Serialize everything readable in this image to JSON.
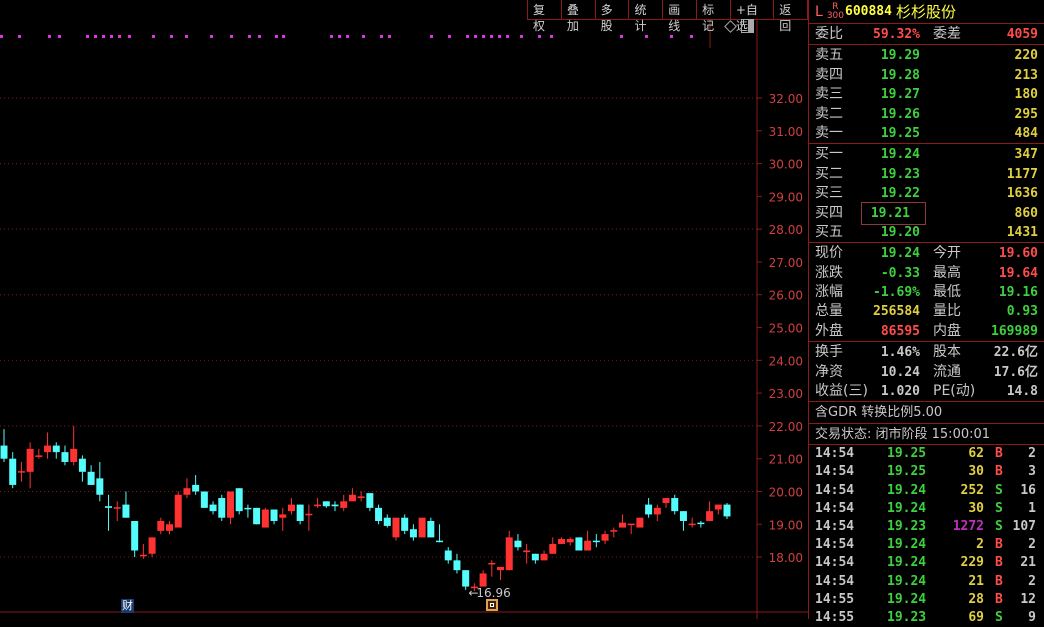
{
  "toolbar": [
    "复权",
    "叠加",
    "多股",
    "统计",
    "画线",
    "标记",
    "+自选",
    "返回"
  ],
  "header": {
    "market": "L",
    "tag_top": "R",
    "tag_bottom": "300",
    "code": "600884",
    "name": "杉杉股份"
  },
  "weibi": {
    "label": "委比",
    "value": "59.32%",
    "diff_label": "委差",
    "diff": "4059"
  },
  "sells": [
    {
      "label": "卖五",
      "price": "19.29",
      "vol": "220"
    },
    {
      "label": "卖四",
      "price": "19.28",
      "vol": "213"
    },
    {
      "label": "卖三",
      "price": "19.27",
      "vol": "180"
    },
    {
      "label": "卖二",
      "price": "19.26",
      "vol": "295"
    },
    {
      "label": "卖一",
      "price": "19.25",
      "vol": "484"
    }
  ],
  "buys": [
    {
      "label": "买一",
      "price": "19.24",
      "vol": "347"
    },
    {
      "label": "买二",
      "price": "19.23",
      "vol": "1177"
    },
    {
      "label": "买三",
      "price": "19.22",
      "vol": "1636"
    },
    {
      "label": "买四",
      "price": "19.21",
      "vol": "860"
    },
    {
      "label": "买五",
      "price": "19.20",
      "vol": "1431"
    }
  ],
  "quote": [
    {
      "l1": "现价",
      "v1": "19.24",
      "c1": "g",
      "l2": "今开",
      "v2": "19.60",
      "c2": "r"
    },
    {
      "l1": "涨跌",
      "v1": "-0.33",
      "c1": "g",
      "l2": "最高",
      "v2": "19.64",
      "c2": "r"
    },
    {
      "l1": "涨幅",
      "v1": "-1.69%",
      "c1": "g",
      "l2": "最低",
      "v2": "19.16",
      "c2": "g"
    },
    {
      "l1": "总量",
      "v1": "256584",
      "c1": "y",
      "l2": "量比",
      "v2": "0.93",
      "c2": "g"
    },
    {
      "l1": "外盘",
      "v1": "86595",
      "c1": "r",
      "l2": "内盘",
      "v2": "169989",
      "c2": "g"
    }
  ],
  "fund": [
    {
      "l1": "换手",
      "v1": "1.46%",
      "l2": "股本",
      "v2": "22.6亿"
    },
    {
      "l1": "净资",
      "v1": "10.24",
      "l2": "流通",
      "v2": "17.6亿"
    },
    {
      "l1": "收益(三)",
      "v1": "1.020",
      "l2": "PE(动)",
      "v2": "14.8"
    }
  ],
  "gdr": "含GDR 转换比例5.00",
  "status": "交易状态: 闭市阶段 15:00:01",
  "ticks": [
    {
      "t": "14:54",
      "p": "19.25",
      "v": "62",
      "bs": "B",
      "n": "2"
    },
    {
      "t": "14:54",
      "p": "19.25",
      "v": "30",
      "bs": "B",
      "n": "3"
    },
    {
      "t": "14:54",
      "p": "19.24",
      "v": "252",
      "bs": "S",
      "n": "16"
    },
    {
      "t": "14:54",
      "p": "19.24",
      "v": "30",
      "bs": "S",
      "n": "1"
    },
    {
      "t": "14:54",
      "p": "19.23",
      "v": "1272",
      "bs": "S",
      "n": "107"
    },
    {
      "t": "14:54",
      "p": "19.24",
      "v": "2",
      "bs": "B",
      "n": "2"
    },
    {
      "t": "14:54",
      "p": "19.24",
      "v": "229",
      "bs": "B",
      "n": "21"
    },
    {
      "t": "14:54",
      "p": "19.24",
      "v": "21",
      "bs": "B",
      "n": "2"
    },
    {
      "t": "14:55",
      "p": "19.24",
      "v": "28",
      "bs": "B",
      "n": "12"
    },
    {
      "t": "14:55",
      "p": "19.23",
      "v": "69",
      "bs": "S",
      "n": "9"
    }
  ],
  "chart_data": {
    "type": "candlestick",
    "y_ticks": [
      "32.00",
      "31.00",
      "30.00",
      "29.00",
      "28.00",
      "27.00",
      "26.00",
      "25.00",
      "24.00",
      "23.00",
      "22.00",
      "21.00",
      "20.00",
      "19.00",
      "18.00"
    ],
    "ylim": [
      18,
      32
    ],
    "low_marker": "16.96",
    "event_marker": "财",
    "colors": {
      "up": "#ff3232",
      "down": "#54fcfc",
      "flat": "#ffffff"
    },
    "ohlc": [
      [
        21.4,
        21.9,
        20.9,
        21.0
      ],
      [
        21.0,
        21.2,
        20.1,
        20.2
      ],
      [
        20.6,
        20.9,
        20.3,
        20.62
      ],
      [
        20.6,
        21.5,
        20.1,
        21.3
      ],
      [
        21.1,
        21.3,
        21.0,
        21.1
      ],
      [
        21.2,
        21.8,
        21.0,
        21.4
      ],
      [
        21.4,
        21.5,
        21.0,
        21.2
      ],
      [
        21.2,
        21.4,
        20.8,
        20.9
      ],
      [
        20.9,
        22.0,
        20.8,
        21.3
      ],
      [
        21.0,
        21.1,
        20.3,
        20.6
      ],
      [
        20.6,
        20.8,
        20.2,
        20.2
      ],
      [
        20.4,
        20.9,
        19.7,
        19.9
      ],
      [
        19.55,
        19.9,
        18.8,
        19.5
      ],
      [
        19.5,
        19.7,
        19.1,
        19.52
      ],
      [
        19.6,
        20.0,
        19.2,
        19.2
      ],
      [
        19.1,
        19.1,
        18.0,
        18.2
      ],
      [
        18.05,
        18.4,
        17.95,
        18.07
      ],
      [
        18.1,
        18.6,
        18.0,
        18.6
      ],
      [
        18.8,
        19.2,
        18.7,
        19.1
      ],
      [
        18.8,
        19.1,
        18.7,
        19.0
      ],
      [
        18.9,
        20.0,
        18.9,
        19.9
      ],
      [
        19.9,
        20.4,
        19.8,
        20.1
      ],
      [
        20.2,
        20.5,
        19.9,
        20.0
      ],
      [
        20.0,
        20.0,
        19.5,
        19.5
      ],
      [
        19.6,
        19.7,
        19.3,
        19.4
      ],
      [
        19.8,
        19.9,
        19.1,
        19.2
      ],
      [
        19.2,
        20.0,
        19.0,
        20.0
      ],
      [
        20.1,
        20.1,
        19.3,
        19.4
      ],
      [
        19.5,
        19.6,
        19.2,
        19.48
      ],
      [
        19.5,
        19.5,
        19.0,
        19.0
      ],
      [
        18.9,
        19.5,
        18.9,
        19.45
      ],
      [
        19.45,
        19.45,
        19.0,
        19.1
      ],
      [
        19.2,
        19.5,
        18.8,
        19.3
      ],
      [
        19.4,
        19.8,
        19.3,
        19.6
      ],
      [
        19.6,
        19.6,
        19.0,
        19.1
      ],
      [
        19.3,
        19.6,
        18.8,
        19.32
      ],
      [
        19.55,
        19.8,
        19.5,
        19.6
      ],
      [
        19.7,
        19.7,
        19.5,
        19.55
      ],
      [
        19.6,
        19.7,
        19.4,
        19.55
      ],
      [
        19.5,
        19.9,
        19.4,
        19.7
      ],
      [
        19.7,
        20.1,
        19.7,
        19.9
      ],
      [
        19.8,
        20.0,
        19.7,
        19.85
      ],
      [
        19.95,
        19.95,
        19.4,
        19.5
      ],
      [
        19.5,
        19.6,
        19.0,
        19.1
      ],
      [
        19.2,
        19.3,
        18.9,
        18.95
      ],
      [
        18.6,
        19.2,
        18.5,
        19.2
      ],
      [
        19.2,
        19.3,
        18.7,
        18.8
      ],
      [
        18.85,
        19.0,
        18.5,
        18.6
      ],
      [
        18.6,
        19.2,
        18.6,
        19.2
      ],
      [
        19.1,
        19.2,
        18.6,
        18.6
      ],
      [
        18.5,
        19.0,
        18.45,
        18.48
      ],
      [
        18.2,
        18.3,
        17.8,
        17.9
      ],
      [
        17.9,
        18.1,
        17.5,
        17.6
      ],
      [
        17.6,
        17.6,
        17.0,
        17.1
      ],
      [
        17.05,
        17.2,
        16.96,
        17.1
      ],
      [
        17.1,
        17.6,
        17.1,
        17.5
      ],
      [
        17.8,
        17.9,
        17.4,
        17.82
      ],
      [
        17.6,
        17.7,
        17.3,
        17.7
      ],
      [
        17.6,
        18.8,
        17.6,
        18.6
      ],
      [
        18.5,
        18.7,
        18.2,
        18.3
      ],
      [
        18.15,
        18.4,
        17.8,
        18.2
      ],
      [
        18.1,
        18.1,
        17.8,
        17.9
      ],
      [
        17.9,
        18.2,
        17.9,
        18.1
      ],
      [
        18.1,
        18.6,
        18.1,
        18.4
      ],
      [
        18.4,
        18.6,
        18.4,
        18.55
      ],
      [
        18.45,
        18.6,
        18.35,
        18.55
      ],
      [
        18.6,
        18.6,
        18.2,
        18.2
      ],
      [
        18.2,
        18.8,
        18.2,
        18.5
      ],
      [
        18.5,
        18.7,
        18.3,
        18.48
      ],
      [
        18.5,
        18.8,
        18.4,
        18.7
      ],
      [
        18.8,
        18.9,
        18.6,
        18.82
      ],
      [
        18.9,
        19.3,
        18.9,
        19.05
      ],
      [
        19.0,
        19.0,
        18.7,
        19.02
      ],
      [
        18.9,
        19.2,
        18.9,
        19.2
      ],
      [
        19.6,
        19.8,
        19.2,
        19.3
      ],
      [
        19.3,
        19.6,
        19.1,
        19.5
      ],
      [
        19.65,
        19.8,
        19.5,
        19.8
      ],
      [
        19.8,
        19.9,
        19.3,
        19.4
      ],
      [
        19.4,
        19.4,
        18.8,
        19.1
      ],
      [
        19.0,
        19.2,
        18.9,
        19.02
      ],
      [
        19.05,
        19.1,
        18.9,
        19.03
      ],
      [
        19.1,
        19.7,
        19.1,
        19.4
      ],
      [
        19.45,
        19.6,
        19.3,
        19.6
      ],
      [
        19.6,
        19.65,
        19.16,
        19.24
      ]
    ]
  }
}
